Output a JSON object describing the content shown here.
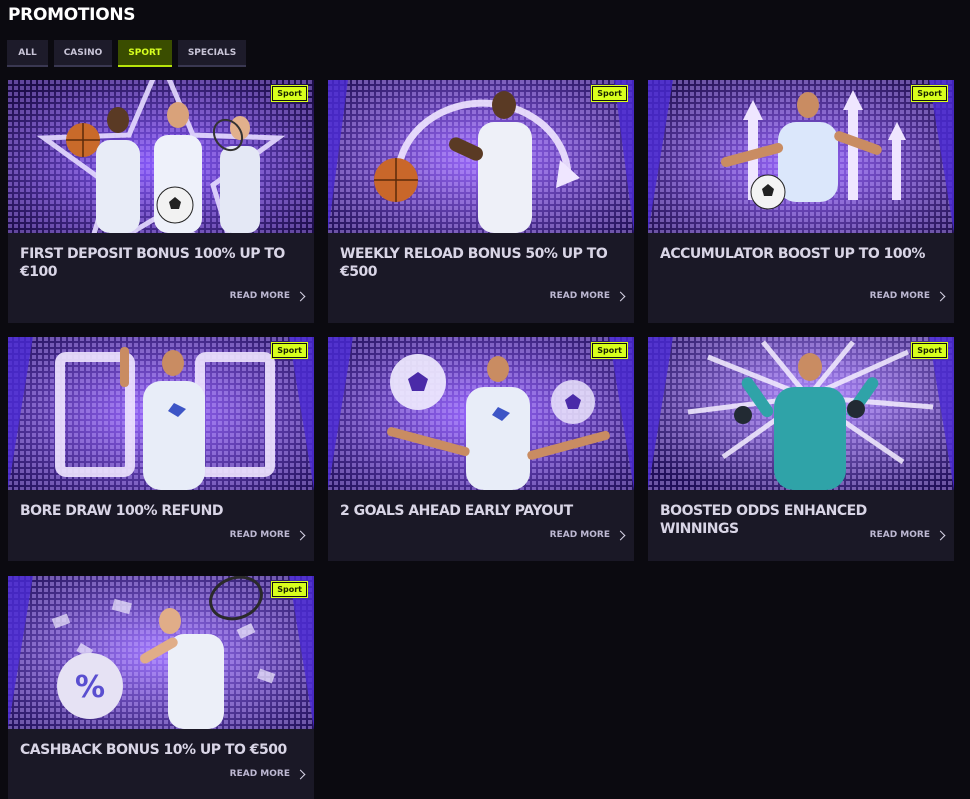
{
  "page": {
    "title": "PROMOTIONS"
  },
  "tabs": [
    {
      "label": "ALL",
      "active": false
    },
    {
      "label": "CASINO",
      "active": false
    },
    {
      "label": "SPORT",
      "active": true
    },
    {
      "label": "SPECIALS",
      "active": false
    }
  ],
  "colors": {
    "accent": "#d9ff1c",
    "card_bg": "#1a1826",
    "page_bg": "#0b0a10",
    "art_purple": "#5a2cc8"
  },
  "promotions": [
    {
      "badge": "Sport",
      "title": "FIRST DEPOSIT BONUS 100% UP TO €100",
      "read_more": "READ MORE",
      "art": "three-athletes-star"
    },
    {
      "badge": "Sport",
      "title": "WEEKLY RELOAD BONUS 50% UP TO €500",
      "read_more": "READ MORE",
      "art": "basketball-player-circular-arrow"
    },
    {
      "badge": "Sport",
      "title": "ACCUMULATOR BOOST UP TO 100%",
      "read_more": "READ MORE",
      "art": "footballer-up-arrows"
    },
    {
      "badge": "Sport",
      "title": "BORE DRAW 100% REFUND",
      "read_more": "READ MORE",
      "art": "player-zero-zero"
    },
    {
      "badge": "Sport",
      "title": "2 GOALS AHEAD EARLY PAYOUT",
      "read_more": "READ MORE",
      "art": "player-two-balls"
    },
    {
      "badge": "Sport",
      "title": "BOOSTED ODDS ENHANCED WINNINGS",
      "read_more": "READ MORE",
      "art": "goalkeeper-burst"
    },
    {
      "badge": "Sport",
      "title": "CASHBACK BONUS 10% UP TO €500",
      "read_more": "READ MORE",
      "art": "tennis-player-percent-ball"
    }
  ]
}
